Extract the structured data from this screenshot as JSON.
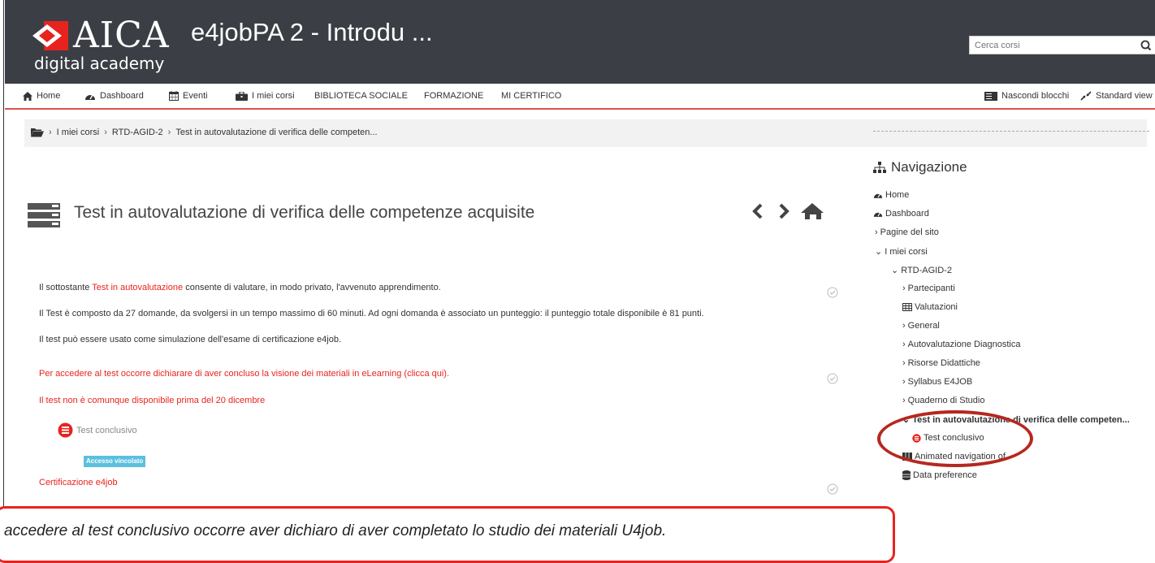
{
  "header": {
    "logo_word": "AICA",
    "logo_sub": "digital academy",
    "course_title": "e4jobPA 2 - Introdu ...",
    "search_placeholder": "Cerca corsi"
  },
  "nav": {
    "home": "Home",
    "dashboard": "Dashboard",
    "events": "Eventi",
    "my_courses": "I miei corsi",
    "social_library": "BIBLIOTECA SOCIALE",
    "training": "FORMAZIONE",
    "certify": "MI CERTIFICO",
    "hide_blocks": "Nascondi blocchi",
    "standard_view": "Standard view"
  },
  "breadcrumb": {
    "items": [
      "I miei corsi",
      "RTD-AGID-2",
      "Test in autovalutazione di verifica delle competen..."
    ]
  },
  "main": {
    "title": "Test in autovalutazione di verifica delle competenze acquisite",
    "p1_before": "Il sottostante ",
    "p1_link": "Test in autovalutazione",
    "p1_after": " consente di valutare, in modo privato, l'avvenuto apprendimento.",
    "p2": "Il Test è composto da 27 domande, da svolgersi in un tempo massimo di 60 minuti. Ad ogni domanda è associato un punteggio: il punteggio totale disponibile è 81 punti.",
    "p3": "Il test può essere usato come simulazione dell'esame di certificazione e4job.",
    "p4": "Per accedere al test occorre dichiarare di aver concluso la visione dei materiali in eLearning (clicca qui).",
    "p5": "Il test non è comunque disponibile prima del 20 dicembre",
    "quiz_label": "Test conclusivo",
    "restricted_badge": "Accesso vincolato",
    "cert_label": "Certificazione e4job"
  },
  "sidebar": {
    "title": "Navigazione",
    "items": {
      "home": "Home",
      "dashboard": "Dashboard",
      "site_pages": "Pagine del sito",
      "my_courses": "I miei corsi",
      "course": "RTD-AGID-2",
      "participants": "Partecipanti",
      "grades": "Valutazioni",
      "general": "General",
      "diagnostic": "Autovalutazione Diagnostica",
      "resources": "Risorse Didattiche",
      "syllabus": "Syllabus E4JOB",
      "notebook": "Quaderno di Studio",
      "current": "Test in autovalutazione di verifica delle competen...",
      "final_test": "Test conclusivo",
      "animated": "Animated navigation of",
      "data_pref": "Data preference"
    }
  },
  "callout": {
    "text": "accedere al test conclusivo occorre aver dichiaro di aver completato lo studio dei materiali U4job."
  },
  "colors": {
    "header_bg": "#3b3f45",
    "accent_red": "#e8231e",
    "badge_blue": "#5bc0de"
  }
}
